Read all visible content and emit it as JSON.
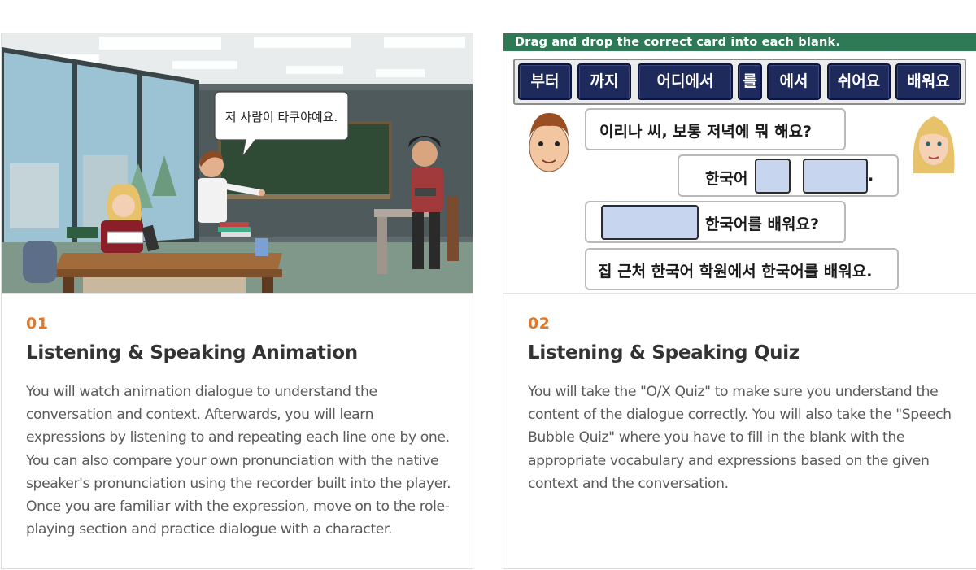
{
  "colors": {
    "accent": "#e07a2a",
    "quiz_header": "#2e7a57",
    "word_card": "#1f2a5c"
  },
  "cards": [
    {
      "number": "01",
      "title": "Listening & Speaking Animation",
      "description": "You will watch animation dialogue to understand the conversation and context. Afterwards, you will learn expressions by listening to and repeating each line one by one. You can also compare your own pronunciation with the native speaker's pronunciation using the recorder built into the player. Once you are familiar with the expression, move on to the role-playing section and practice dialogue with a character.",
      "scene": {
        "speech_bubble": "저 사람이 타쿠야예요."
      }
    },
    {
      "number": "02",
      "title": "Listening & Speaking Quiz",
      "description": "You will take the \"O/X Quiz\" to make sure you understand the content of the dialogue correctly. You will also take the \"Speech Bubble Quiz\" where you have to fill in the blank with the appropriate vocabulary and expressions based on the given context and the conversation.",
      "quiz": {
        "instruction": "Drag and drop the correct card into each blank.",
        "word_cards": [
          "부터",
          "까지",
          "어디에서",
          "를",
          "에서",
          "쉬어요",
          "배워요"
        ],
        "line1": "이리나 씨, 보통 저녁에 뭐 해요?",
        "line2_prefix": "한국어",
        "line2_suffix": ".",
        "line3_suffix": "한국어를 배워요?",
        "line4": "집 근처 한국어 학원에서 한국어를 배워요."
      }
    }
  ]
}
